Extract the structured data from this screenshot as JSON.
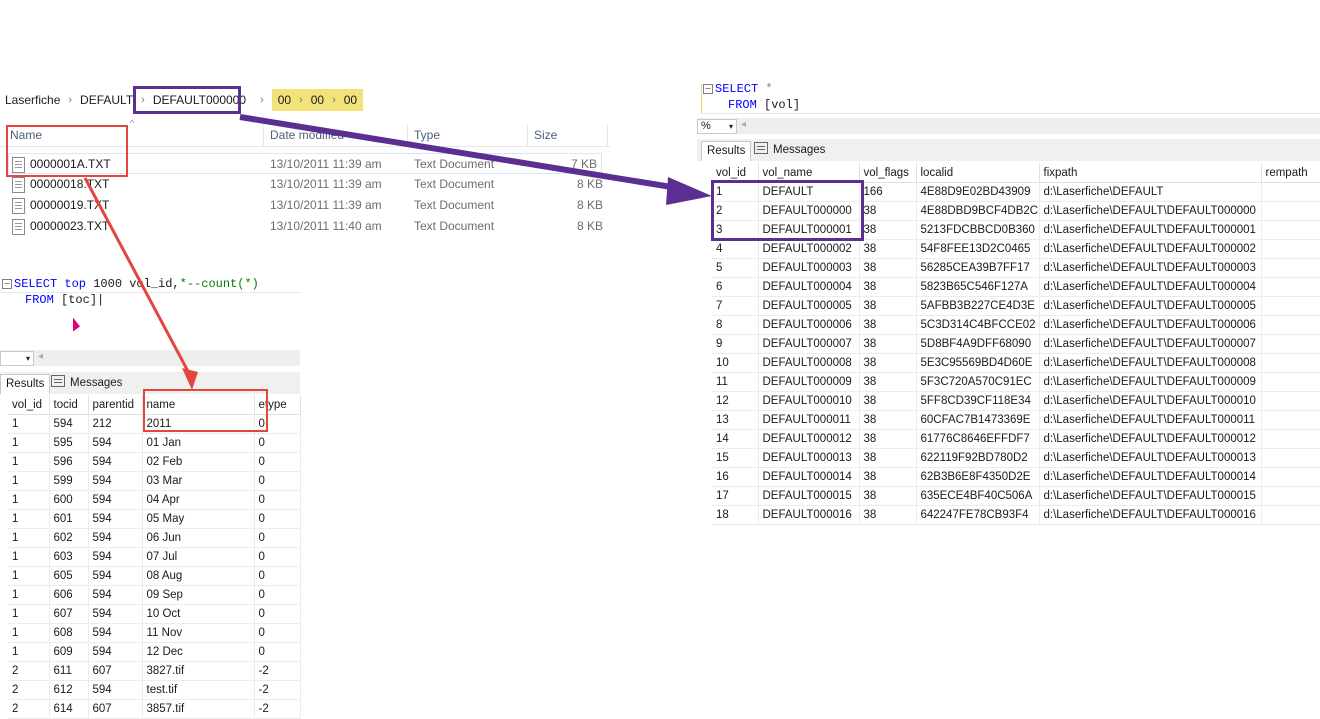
{
  "breadcrumb": {
    "items": [
      "Laserfiche",
      "DEFAULT",
      "DEFAULT000000"
    ],
    "highlighted": [
      "00",
      "00",
      "00"
    ]
  },
  "file_list": {
    "columns": [
      "Name",
      "Date modified",
      "Type",
      "Size"
    ],
    "rows": [
      {
        "name": "0000001A.TXT",
        "date": "13/10/2011 11:39 am",
        "type": "Text Document",
        "size": "7 KB"
      },
      {
        "name": "00000018.TXT",
        "date": "13/10/2011 11:39 am",
        "type": "Text Document",
        "size": "8 KB"
      },
      {
        "name": "00000019.TXT",
        "date": "13/10/2011 11:39 am",
        "type": "Text Document",
        "size": "8 KB"
      },
      {
        "name": "00000023.TXT",
        "date": "13/10/2011 11:40 am",
        "type": "Text Document",
        "size": "8 KB"
      }
    ]
  },
  "query_left": {
    "line1_kw": "SELECT top",
    "line1_rest": " 1000 vol_id,",
    "line1_comment": "*--count(*)",
    "line2_kw": "FROM",
    "line2_rest": " [toc]",
    "zoom": "",
    "tab_results": "Results",
    "tab_messages": "Messages",
    "columns": [
      "vol_id",
      "tocid",
      "parentid",
      "name",
      "etype"
    ],
    "rows": [
      [
        "1",
        "594",
        "212",
        "2011",
        "0"
      ],
      [
        "1",
        "595",
        "594",
        "01 Jan",
        "0"
      ],
      [
        "1",
        "596",
        "594",
        "02 Feb",
        "0"
      ],
      [
        "1",
        "599",
        "594",
        "03 Mar",
        "0"
      ],
      [
        "1",
        "600",
        "594",
        "04 Apr",
        "0"
      ],
      [
        "1",
        "601",
        "594",
        "05 May",
        "0"
      ],
      [
        "1",
        "602",
        "594",
        "06 Jun",
        "0"
      ],
      [
        "1",
        "603",
        "594",
        "07 Jul",
        "0"
      ],
      [
        "1",
        "605",
        "594",
        "08 Aug",
        "0"
      ],
      [
        "1",
        "606",
        "594",
        "09 Sep",
        "0"
      ],
      [
        "1",
        "607",
        "594",
        "10 Oct",
        "0"
      ],
      [
        "1",
        "608",
        "594",
        "11 Nov",
        "0"
      ],
      [
        "1",
        "609",
        "594",
        "12 Dec",
        "0"
      ],
      [
        "2",
        "611",
        "607",
        "3827.tif",
        "-2"
      ],
      [
        "2",
        "612",
        "594",
        "test.tif",
        "-2"
      ],
      [
        "2",
        "614",
        "607",
        "3857.tif",
        "-2"
      ]
    ]
  },
  "query_right": {
    "line1_kw": "SELECT",
    "line1_rest": " *",
    "line2_kw": "FROM",
    "line2_rest": " [vol]",
    "zoom": "%",
    "tab_results": "Results",
    "tab_messages": "Messages",
    "columns": [
      "vol_id",
      "vol_name",
      "vol_flags",
      "localid",
      "fixpath",
      "rempath"
    ],
    "rows": [
      [
        "1",
        "DEFAULT",
        "166",
        "4E88D9E02BD43909",
        "d:\\Laserfiche\\DEFAULT",
        ""
      ],
      [
        "2",
        "DEFAULT000000",
        "38",
        "4E88DBD9BCF4DB2C",
        "d:\\Laserfiche\\DEFAULT\\DEFAULT000000",
        ""
      ],
      [
        "3",
        "DEFAULT000001",
        "38",
        "5213FDCBBCD0B360",
        "d:\\Laserfiche\\DEFAULT\\DEFAULT000001",
        ""
      ],
      [
        "4",
        "DEFAULT000002",
        "38",
        "54F8FEE13D2C0465",
        "d:\\Laserfiche\\DEFAULT\\DEFAULT000002",
        ""
      ],
      [
        "5",
        "DEFAULT000003",
        "38",
        "56285CEA39B7FF17",
        "d:\\Laserfiche\\DEFAULT\\DEFAULT000003",
        ""
      ],
      [
        "6",
        "DEFAULT000004",
        "38",
        "5823B65C546F127A",
        "d:\\Laserfiche\\DEFAULT\\DEFAULT000004",
        ""
      ],
      [
        "7",
        "DEFAULT000005",
        "38",
        "5AFBB3B227CE4D3E",
        "d:\\Laserfiche\\DEFAULT\\DEFAULT000005",
        ""
      ],
      [
        "8",
        "DEFAULT000006",
        "38",
        "5C3D314C4BFCCE02",
        "d:\\Laserfiche\\DEFAULT\\DEFAULT000006",
        ""
      ],
      [
        "9",
        "DEFAULT000007",
        "38",
        "5D8BF4A9DFF68090",
        "d:\\Laserfiche\\DEFAULT\\DEFAULT000007",
        ""
      ],
      [
        "10",
        "DEFAULT000008",
        "38",
        "5E3C95569BD4D60E",
        "d:\\Laserfiche\\DEFAULT\\DEFAULT000008",
        ""
      ],
      [
        "11",
        "DEFAULT000009",
        "38",
        "5F3C720A570C91EC",
        "d:\\Laserfiche\\DEFAULT\\DEFAULT000009",
        ""
      ],
      [
        "12",
        "DEFAULT000010",
        "38",
        "5FF8CD39CF118E34",
        "d:\\Laserfiche\\DEFAULT\\DEFAULT000010",
        ""
      ],
      [
        "13",
        "DEFAULT000011",
        "38",
        "60CFAC7B1473369E",
        "d:\\Laserfiche\\DEFAULT\\DEFAULT000011",
        ""
      ],
      [
        "14",
        "DEFAULT000012",
        "38",
        "61776C8646EFFDF7",
        "d:\\Laserfiche\\DEFAULT\\DEFAULT000012",
        ""
      ],
      [
        "15",
        "DEFAULT000013",
        "38",
        "622119F92BD780D2",
        "d:\\Laserfiche\\DEFAULT\\DEFAULT000013",
        ""
      ],
      [
        "16",
        "DEFAULT000014",
        "38",
        "62B3B6E8F4350D2E",
        "d:\\Laserfiche\\DEFAULT\\DEFAULT000014",
        ""
      ],
      [
        "17",
        "DEFAULT000015",
        "38",
        "635ECE4BF40C506A",
        "d:\\Laserfiche\\DEFAULT\\DEFAULT000015",
        ""
      ],
      [
        "18",
        "DEFAULT000016",
        "38",
        "642247FE78CB93F4",
        "d:\\Laserfiche\\DEFAULT\\DEFAULT000016",
        ""
      ]
    ]
  },
  "annotation_colors": {
    "red": "#e2463f",
    "purple": "#5b2f91",
    "highlight": "#f3e27a"
  }
}
